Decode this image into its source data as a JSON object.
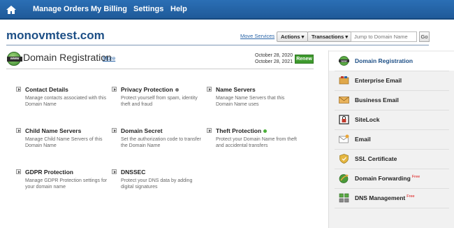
{
  "nav": {
    "items": [
      "Manage Orders",
      "My Billing",
      "Settings",
      "Help"
    ]
  },
  "header": {
    "domain": "monovmtest.com",
    "move_services": "Move Services",
    "actions_label": "Actions",
    "transactions_label": "Transactions",
    "jump_placeholder": "Jump to Domain Name",
    "go_label": "Go"
  },
  "page": {
    "icon_text": "www",
    "title": "Domain Registration",
    "more_link": "More",
    "date_registered": "October 28, 2020",
    "date_expires": "October 28, 2021",
    "renew_label": "Renew"
  },
  "items": [
    {
      "title": "Contact Details",
      "desc": "Manage contacts associated with this Domain Name",
      "status": ""
    },
    {
      "title": "Privacy Protection",
      "desc": "Protect yourself from spam, identity theft and fraud",
      "status": "gray"
    },
    {
      "title": "Name Servers",
      "desc": "Manage Name Servers that this Domain Name uses",
      "status": ""
    },
    {
      "title": "Child Name Servers",
      "desc": "Manage Child Name Servers of this Domain Name",
      "status": ""
    },
    {
      "title": "Domain Secret",
      "desc": "Set the authorization code to transfer the Domain Name",
      "status": ""
    },
    {
      "title": "Theft Protection",
      "desc": "Protect your Domain Name from theft and accidental transfers",
      "status": "green"
    },
    {
      "title": "GDPR Protection",
      "desc": "Manage GDPR Protection settings for your domain name",
      "status": ""
    },
    {
      "title": "DNSSEC",
      "desc": "Protect your DNS data by adding digital signatures",
      "status": ""
    }
  ],
  "sidebar": {
    "items": [
      {
        "label": "Domain Registration",
        "icon": "www-globe-icon",
        "free": ""
      },
      {
        "label": "Enterprise Email",
        "icon": "enterprise-email-icon",
        "free": ""
      },
      {
        "label": "Business Email",
        "icon": "envelope-icon",
        "free": ""
      },
      {
        "label": "SiteLock",
        "icon": "sitelock-icon",
        "free": ""
      },
      {
        "label": "Email",
        "icon": "email-icon",
        "free": ""
      },
      {
        "label": "SSL Certificate",
        "icon": "ssl-shield-icon",
        "free": ""
      },
      {
        "label": "Domain Forwarding",
        "icon": "domain-forwarding-icon",
        "free": "Free"
      },
      {
        "label": "DNS Management",
        "icon": "dns-management-icon",
        "free": "Free"
      }
    ]
  },
  "colors": {
    "nav_blue": "#1f5a99",
    "brand_blue": "#1d4f86",
    "renew_green": "#3e9a2e",
    "free_red": "#dd1111",
    "status_gray": "#7a7a7a",
    "status_green": "#4caf3a"
  }
}
